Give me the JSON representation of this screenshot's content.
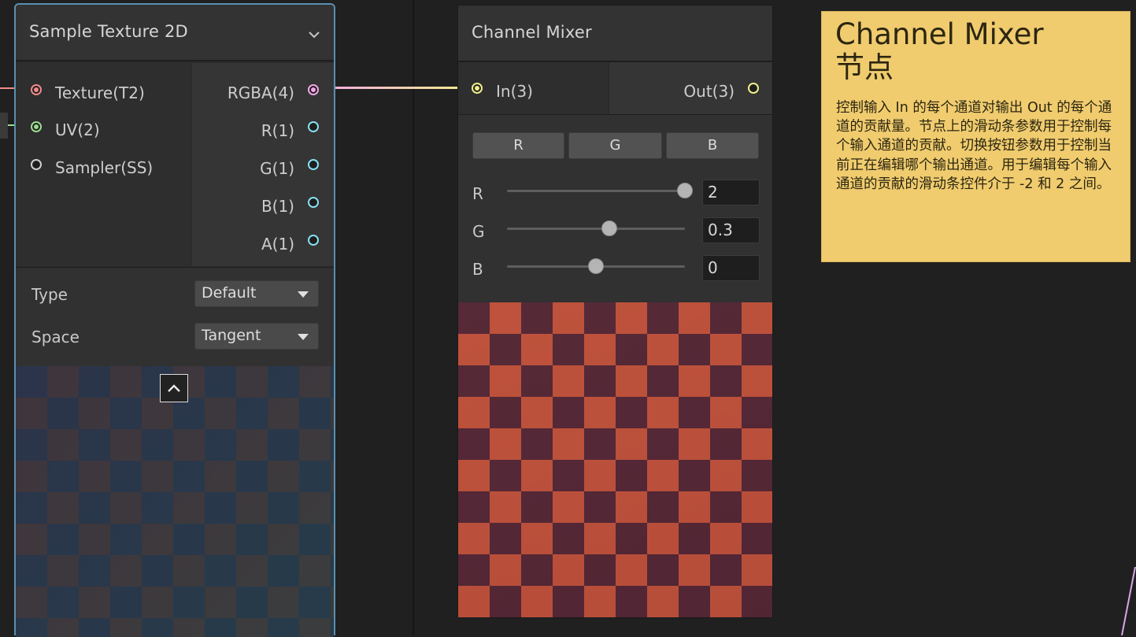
{
  "sample_texture": {
    "title": "Sample Texture 2D",
    "inputs": [
      "Texture(T2)",
      "UV(2)",
      "Sampler(SS)"
    ],
    "outputs": [
      "RGBA(4)",
      "R(1)",
      "G(1)",
      "B(1)",
      "A(1)"
    ],
    "type_label": "Type",
    "type_value": "Default",
    "space_label": "Space",
    "space_value": "Tangent"
  },
  "channel_mixer": {
    "title": "Channel Mixer",
    "input": "In(3)",
    "output": "Out(3)",
    "channel_buttons": [
      "R",
      "G",
      "B"
    ],
    "sliders": [
      {
        "label": "R",
        "value": "2",
        "level": 2
      },
      {
        "label": "G",
        "value": "0.3",
        "level": 0.3
      },
      {
        "label": "B",
        "value": "0",
        "level": 0
      }
    ],
    "slider_range": [
      -2,
      2
    ]
  },
  "sticky_note": {
    "title_line1": "Channel Mixer",
    "title_line2": "节点",
    "body": "控制输入 In 的每个通道对输出 Out 的每个通道的贡献量。节点上的滑动条参数用于控制每个输入通道的贡献。切换按钮参数用于控制当前正在编辑哪个输出通道。用于编辑每个输入通道的贡献的滑动条控件介于 -2 和 2 之间。"
  },
  "colors": {
    "texture_port": "#f08a8a",
    "uv_port": "#9bdc8f",
    "vector4_port": "#f2a6e6",
    "vector3_port": "#f2ef8a",
    "vector1_port": "#86dff2",
    "selection_outline": "#5a8fb0",
    "note_bg": "#f0cc6f"
  },
  "icons": {
    "collapse": "chevron-down-icon",
    "preview_toggle": "chevron-up-icon"
  }
}
